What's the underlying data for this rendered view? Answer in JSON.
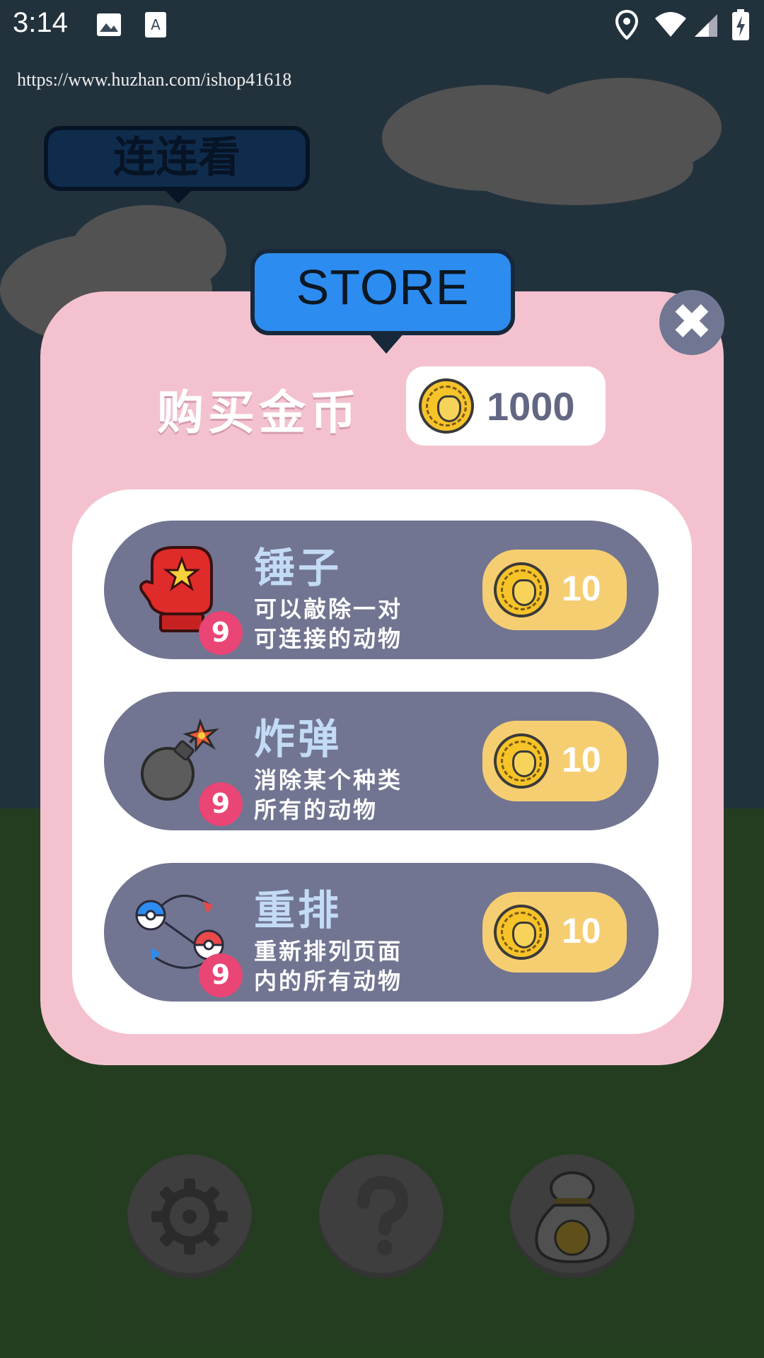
{
  "status_bar": {
    "time": "3:14"
  },
  "url_watermark": "https://www.huzhan.com/ishop41618",
  "game_title": "连连看",
  "store": {
    "banner": "STORE",
    "buy_title": "购买金币",
    "coins": "1000",
    "items": [
      {
        "name": "锤子",
        "desc_line1": "可以敲除一对",
        "desc_line2": "可连接的动物",
        "qty": "9",
        "price": "10",
        "icon": "boxing-glove-icon"
      },
      {
        "name": "炸弹",
        "desc_line1": "消除某个种类",
        "desc_line2": "所有的动物",
        "qty": "9",
        "price": "10",
        "icon": "bomb-icon"
      },
      {
        "name": "重排",
        "desc_line1": "重新排列页面",
        "desc_line2": "内的所有动物",
        "qty": "9",
        "price": "10",
        "icon": "shuffle-icon"
      }
    ]
  },
  "bottom_bar": [
    {
      "icon": "settings-gear-icon"
    },
    {
      "icon": "help-question-icon"
    },
    {
      "icon": "coin-bag-icon"
    }
  ],
  "colors": {
    "modal_bg": "#f4c2cf",
    "item_bg": "#717591",
    "price_bg": "#f6ce72",
    "badge": "#e94575",
    "store_banner": "#2d8cf0"
  }
}
